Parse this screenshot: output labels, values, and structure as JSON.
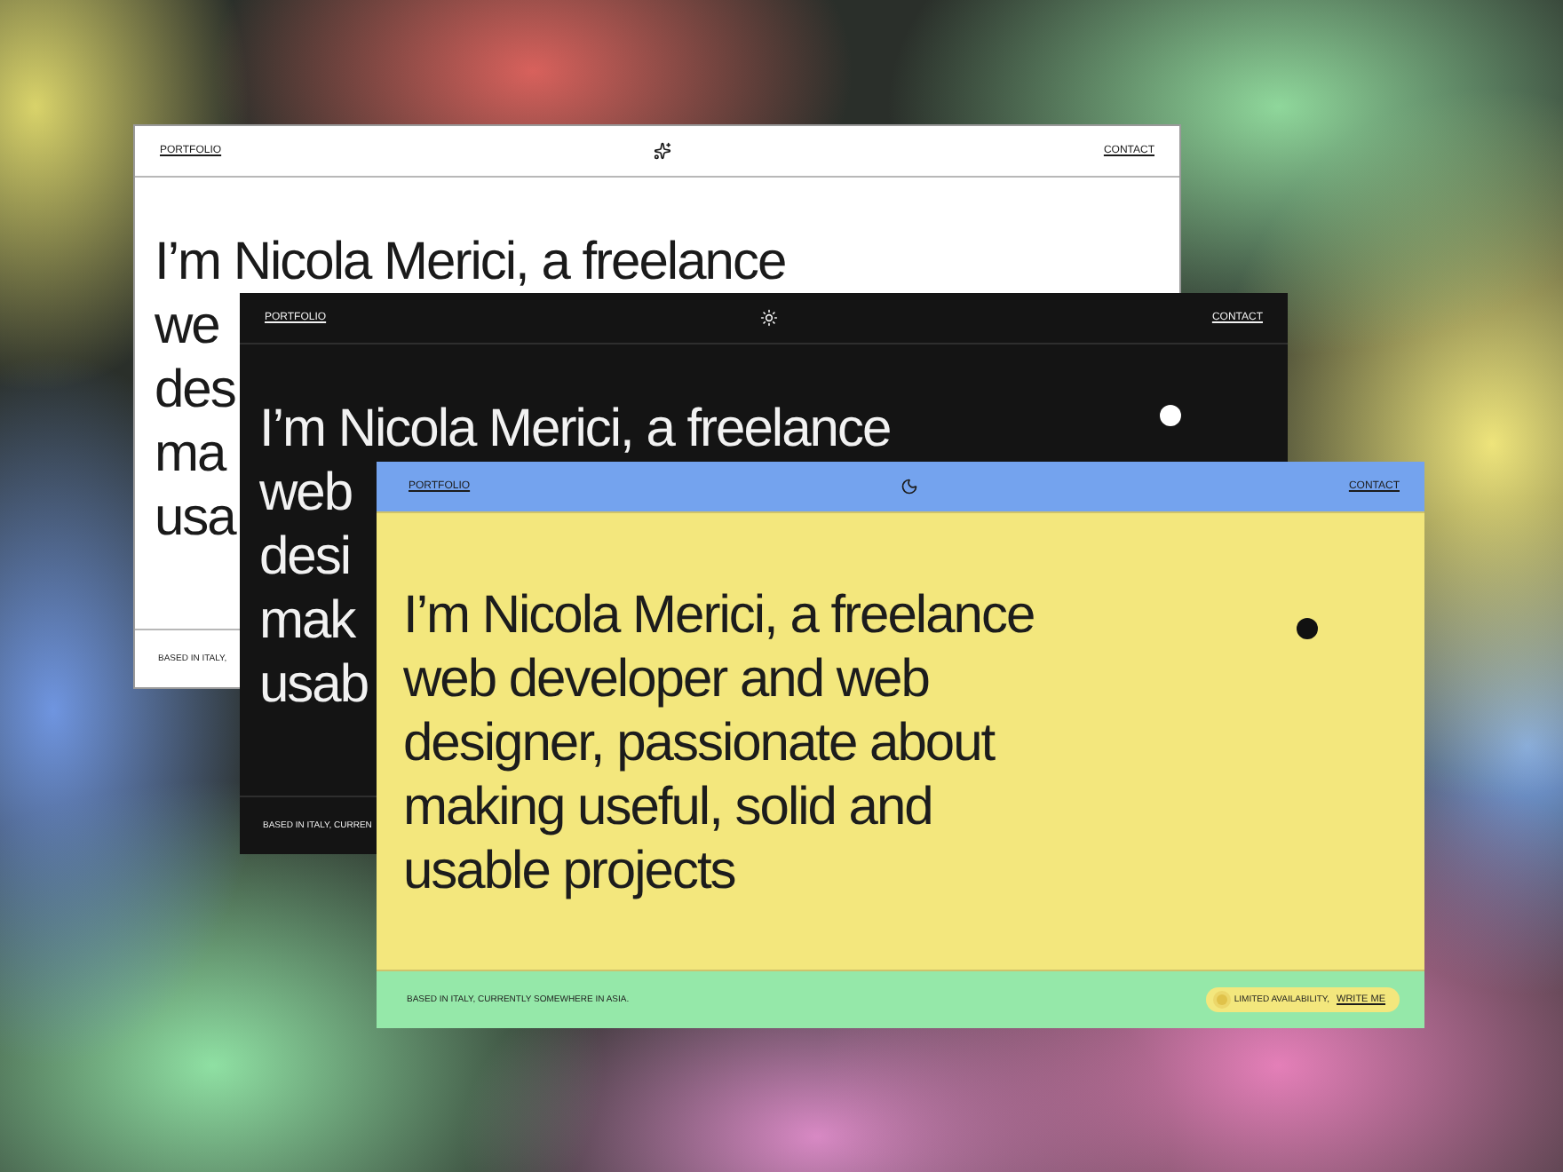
{
  "cards": [
    {
      "kind": "light",
      "nav_left": "PORTFOLIO",
      "nav_right": "CONTACT",
      "hero_lines": [
        "I’m Nicola Merici, a freelance",
        "we",
        "des",
        "ma",
        "usa"
      ],
      "footer_text": "BASED IN ITALY,"
    },
    {
      "kind": "dark",
      "nav_left": "PORTFOLIO",
      "nav_right": "CONTACT",
      "hero_lines": [
        "I’m Nicola Merici, a freelance",
        "web",
        "desi",
        "mak",
        "usab"
      ],
      "dot": true,
      "footer_text": "BASED IN ITALY, CURREN"
    },
    {
      "kind": "color",
      "nav_left": "PORTFOLIO",
      "nav_right": "CONTACT",
      "hero_lines": [
        "I’m Nicola Merici, a freelance",
        "web developer and web",
        "designer, passionate about",
        "making useful, solid and",
        "usable projects"
      ],
      "dot": true,
      "footer_text": "BASED IN ITALY, CURRENTLY SOMEWHERE IN ASIA.",
      "badge": {
        "text": "LIMITED AVAILABILITY,",
        "link": "WRITE ME"
      }
    }
  ]
}
